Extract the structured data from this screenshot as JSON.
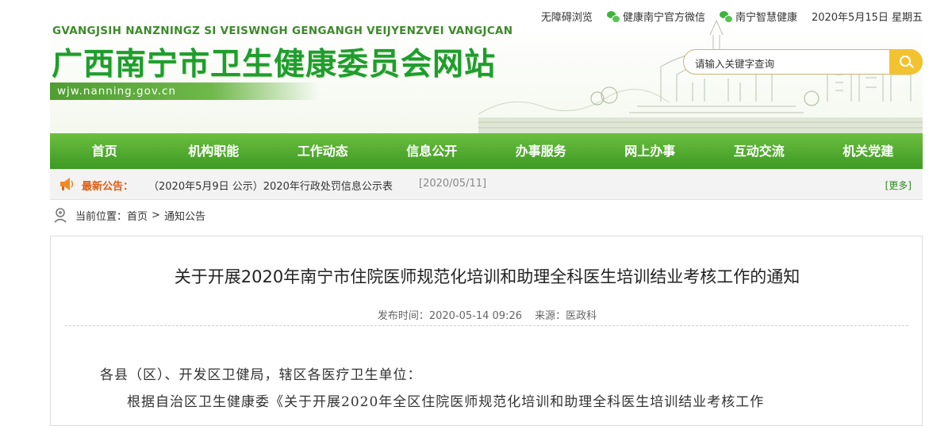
{
  "topbar": {
    "accessible": "无障碍浏览",
    "wechat1": "健康南宁官方微信",
    "wechat2": "南宁智慧健康",
    "date": "2020年5月15日 星期五"
  },
  "header": {
    "pinyin": "GVANGJSIH NANZNINGZ SI VEISWNGH GENGANGH VEIJYENZVEI VANGJCAN",
    "title": "广西南宁市卫生健康委员会网站",
    "domain": "wjw.nanning.gov.cn"
  },
  "search": {
    "placeholder": "请输入关键字查询"
  },
  "nav": [
    {
      "label": "首页"
    },
    {
      "label": "机构职能"
    },
    {
      "label": "工作动态"
    },
    {
      "label": "信息公开"
    },
    {
      "label": "办事服务"
    },
    {
      "label": "网上办事"
    },
    {
      "label": "互动交流"
    },
    {
      "label": "机关党建"
    }
  ],
  "notice": {
    "label": "最新公告：",
    "text": "（2020年5月9日 公示）2020年行政处罚信息公示表",
    "date": "[2020/05/11]",
    "more": "[更多]"
  },
  "breadcrumb": {
    "prefix": "当前位置：",
    "home": "首页",
    "sep": ">",
    "current": "通知公告"
  },
  "article": {
    "title": "关于开展2020年南宁市住院医师规范化培训和助理全科医生培训结业考核工作的通知",
    "published": "发布时间：2020-05-14 09:26",
    "source": "来源：医政科",
    "salutation": "各县（区）、开发区卫健局，辖区各医疗卫生单位：",
    "body": "根据自治区卫生健康委《关于开展2020年全区住院医师规范化培训和助理全科医生培训结业考核工作"
  },
  "colors": {
    "nav_green": "#3d9a24",
    "title_green": "#1f9d2e",
    "notice_orange": "#e05a10",
    "search_yellow": "#f2c230"
  }
}
